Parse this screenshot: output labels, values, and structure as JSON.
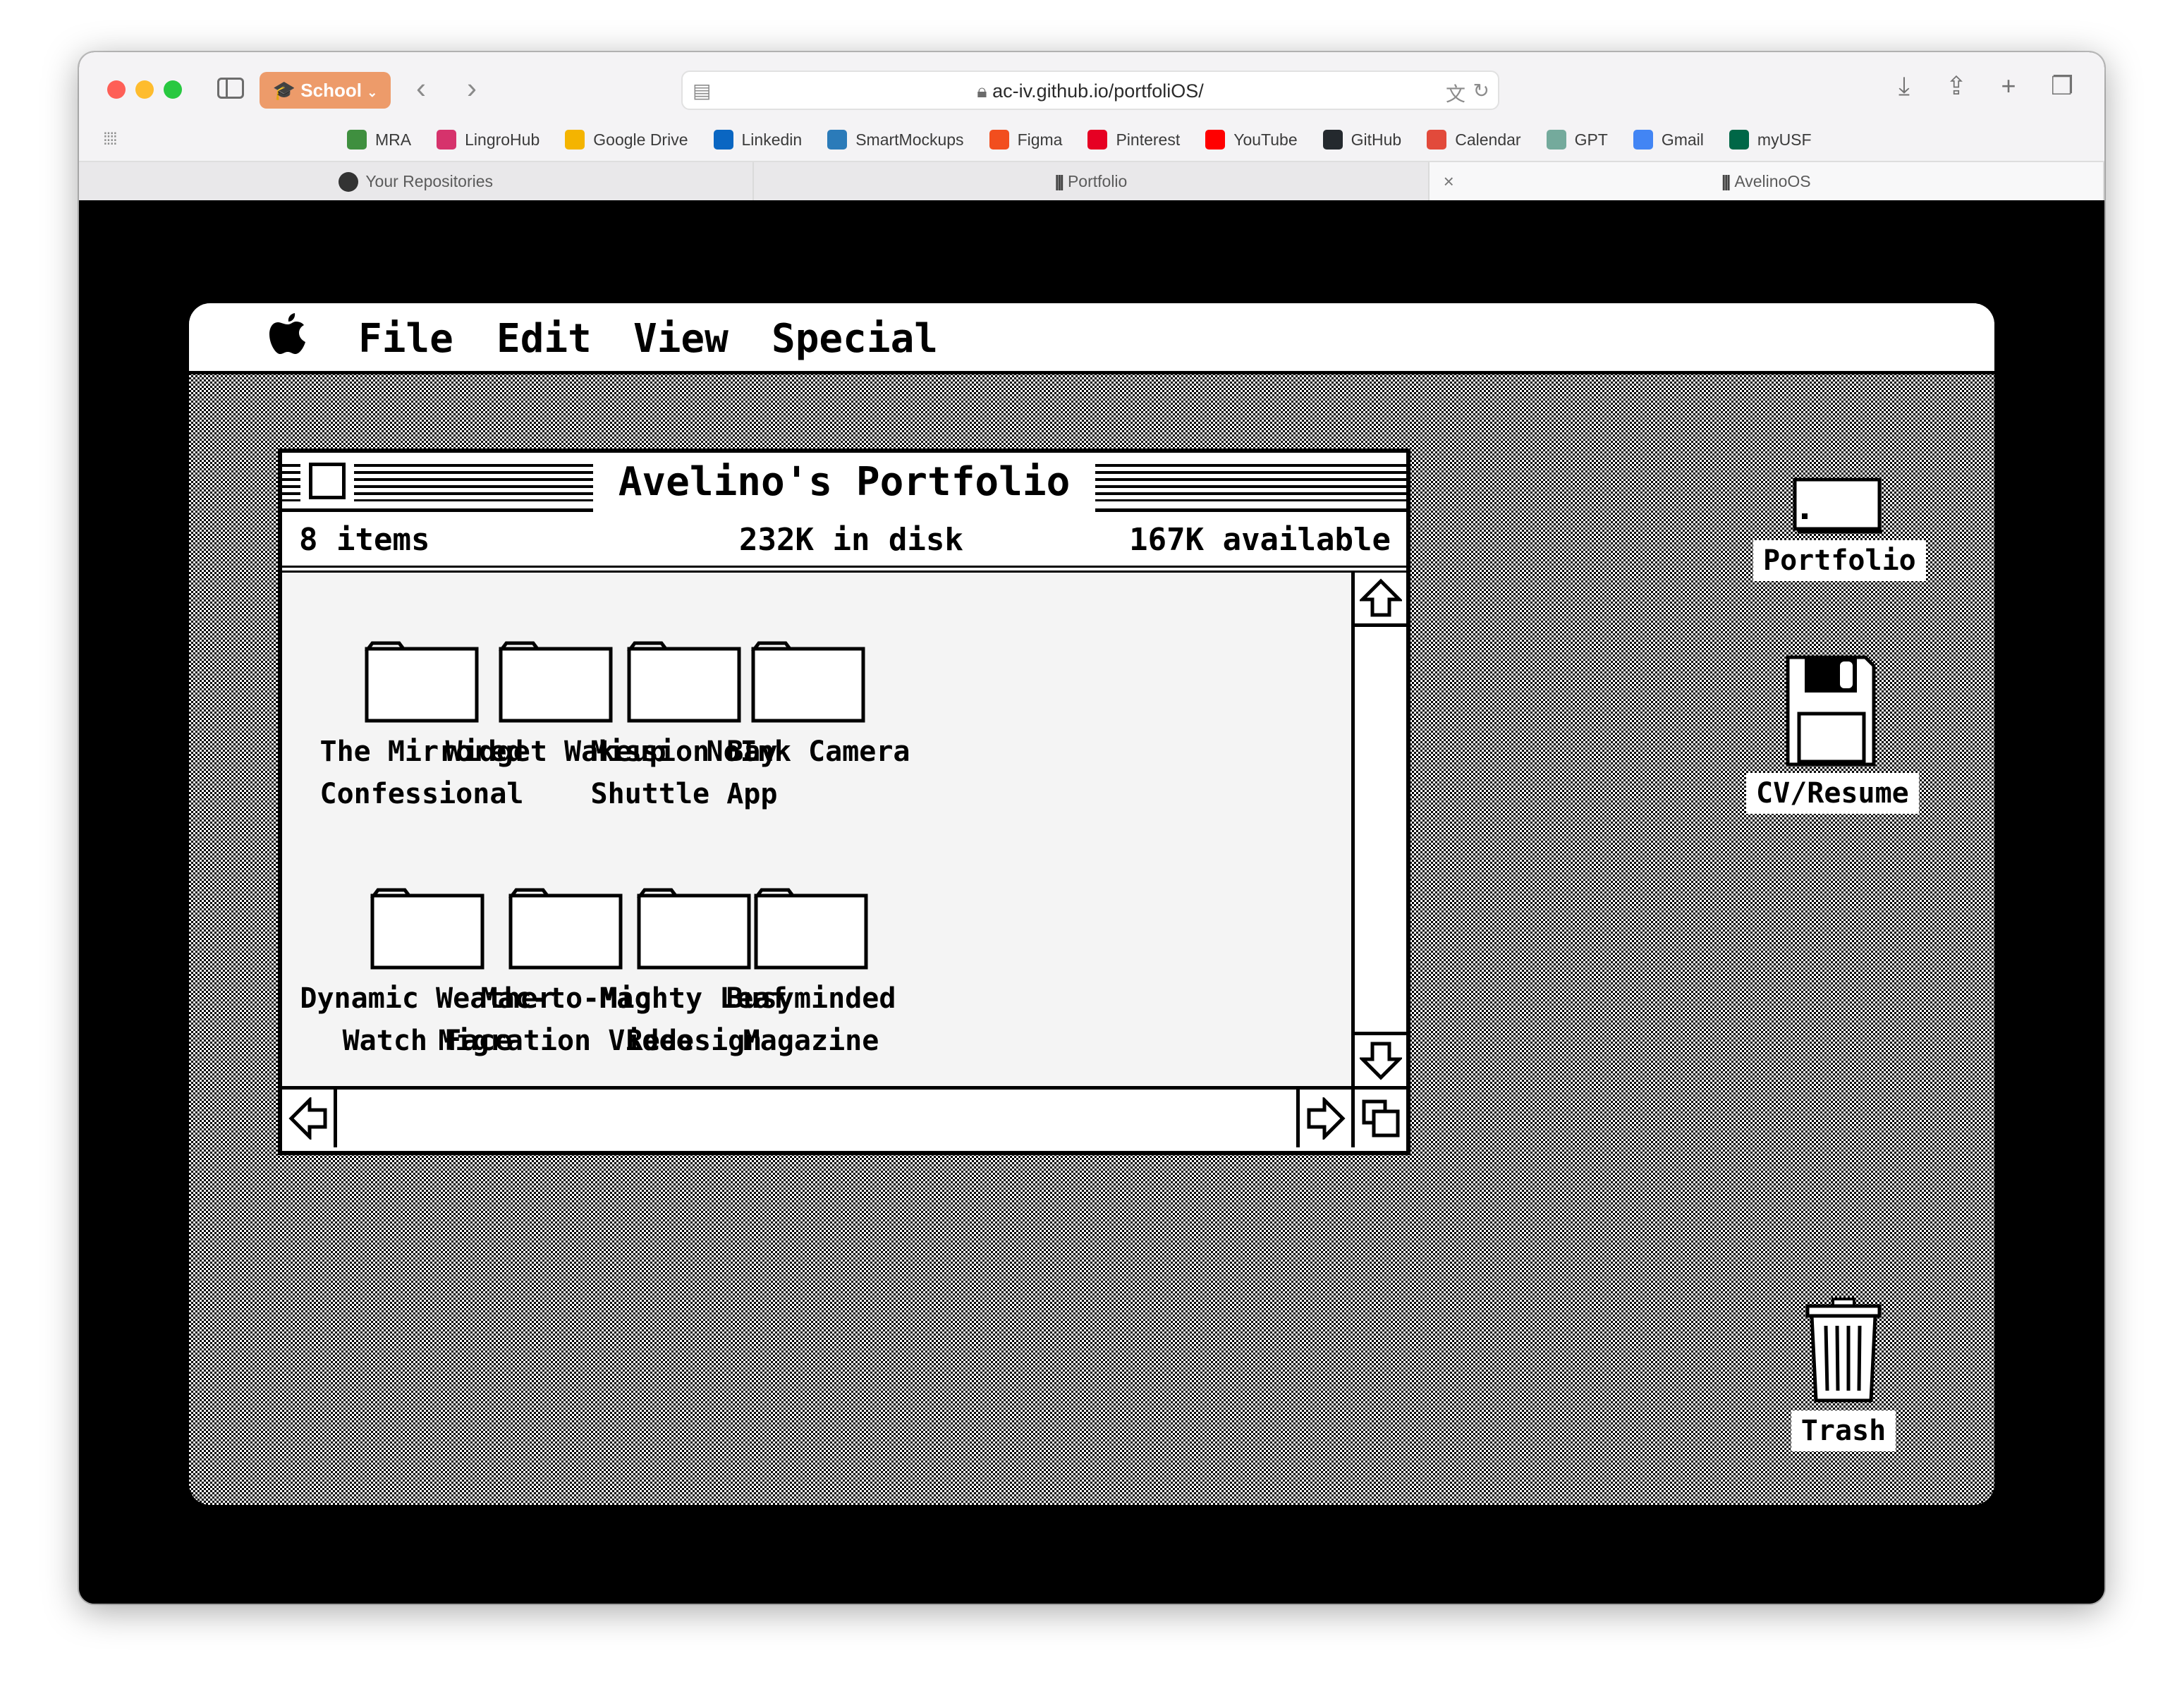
{
  "browser": {
    "tab_group": "School",
    "url": "ac-iv.github.io/portfoliOS/",
    "bookmarks": [
      {
        "label": "MRA",
        "icon": "mra-icon",
        "color": "#3f8f3f"
      },
      {
        "label": "LingroHub",
        "icon": "lingrohub-icon",
        "color": "#d6336c"
      },
      {
        "label": "Google Drive",
        "icon": "google-drive-icon",
        "color": "#f4b400"
      },
      {
        "label": "Linkedin",
        "icon": "linkedin-icon",
        "color": "#0a66c2"
      },
      {
        "label": "SmartMockups",
        "icon": "smartmockups-icon",
        "color": "#2b7bb9"
      },
      {
        "label": "Figma",
        "icon": "figma-icon",
        "color": "#f24e1e"
      },
      {
        "label": "Pinterest",
        "icon": "pinterest-icon",
        "color": "#e60023"
      },
      {
        "label": "YouTube",
        "icon": "youtube-icon",
        "color": "#ff0000"
      },
      {
        "label": "GitHub",
        "icon": "github-icon",
        "color": "#24292e"
      },
      {
        "label": "Calendar",
        "icon": "calendar-icon",
        "color": "#e24a3b"
      },
      {
        "label": "GPT",
        "icon": "gpt-icon",
        "color": "#74aa9c"
      },
      {
        "label": "Gmail",
        "icon": "gmail-icon",
        "color": "#4285f4"
      },
      {
        "label": "myUSF",
        "icon": "myusf-icon",
        "color": "#006747"
      }
    ],
    "tabs": [
      {
        "label": "Your Repositories",
        "icon": "github-icon"
      },
      {
        "label": "Portfolio",
        "icon": "portfolio-logo-icon"
      },
      {
        "label": "AvelinoOS",
        "icon": "portfolio-logo-icon"
      }
    ],
    "close_glyph": "×"
  },
  "os": {
    "menu": [
      "File",
      "Edit",
      "View",
      "Special"
    ],
    "window": {
      "title": "Avelino's Portfolio",
      "items": "8 items",
      "disk": "232K in disk",
      "available": "167K available",
      "folders": [
        {
          "line1": "The Mirrored",
          "line2": "Confessional"
        },
        {
          "line1": "Widget Wakeup",
          "line2": ""
        },
        {
          "line1": "Mission Bay",
          "line2": "Shuttle App"
        },
        {
          "line1": "NoInk Camera",
          "line2": ""
        },
        {
          "line1": "Dynamic Weather",
          "line2": "Watch Face"
        },
        {
          "line1": "Mac-to-Mac",
          "line2": "Migration Video"
        },
        {
          "line1": "Mighty Leaf",
          "line2": "Redesign"
        },
        {
          "line1": "Busyminded",
          "line2": "Magazine"
        }
      ]
    },
    "desktop": {
      "portfolio": "Portfolio",
      "cv": "CV/Resume",
      "trash": "Trash"
    }
  }
}
